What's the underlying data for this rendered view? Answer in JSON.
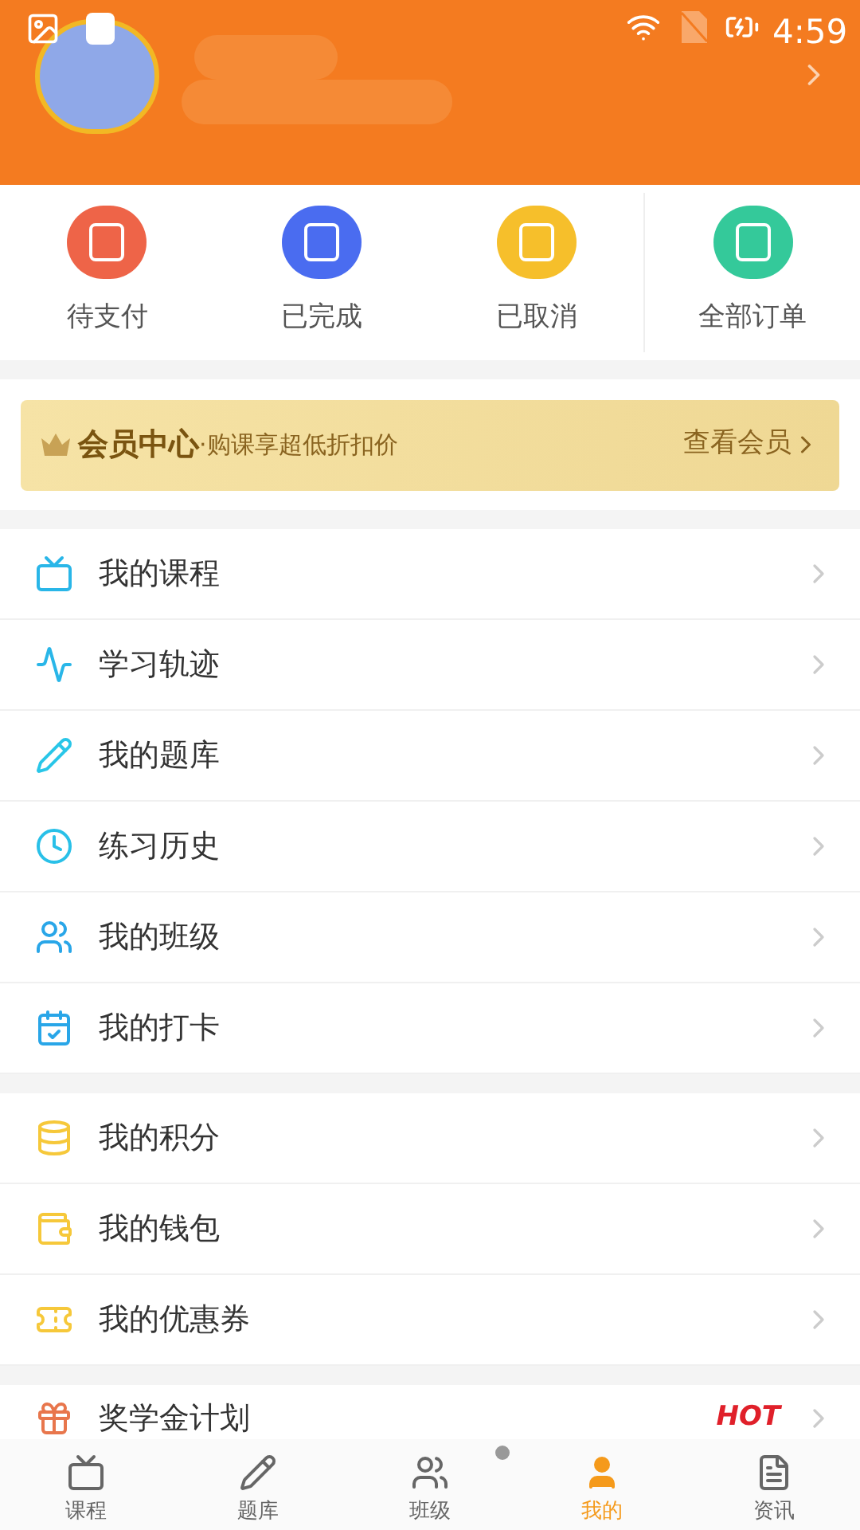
{
  "status_bar": {
    "time": "4:59"
  },
  "orders": [
    {
      "label": "待支付",
      "color": "#ee6448"
    },
    {
      "label": "已完成",
      "color": "#4a6cf0"
    },
    {
      "label": "已取消",
      "color": "#f6bf2b"
    },
    {
      "label": "全部订单",
      "color": "#34c99a"
    }
  ],
  "member_banner": {
    "title": "会员中心",
    "subtitle": "·购课享超低折扣价",
    "link": "查看会员"
  },
  "menu_groups": [
    {
      "items": [
        {
          "label": "我的课程"
        },
        {
          "label": "学习轨迹"
        },
        {
          "label": "我的题库"
        },
        {
          "label": "练习历史"
        },
        {
          "label": "我的班级"
        },
        {
          "label": "我的打卡"
        }
      ]
    },
    {
      "items": [
        {
          "label": "我的积分"
        },
        {
          "label": "我的钱包"
        },
        {
          "label": "我的优惠券"
        }
      ]
    },
    {
      "items": [
        {
          "label": "奖学金计划",
          "badge": "HOT"
        }
      ]
    }
  ],
  "bottom_nav": [
    {
      "label": "课程",
      "selected": false
    },
    {
      "label": "题库",
      "selected": false
    },
    {
      "label": "班级",
      "selected": false
    },
    {
      "label": "我的",
      "selected": true
    },
    {
      "label": "资讯",
      "selected": false
    }
  ]
}
